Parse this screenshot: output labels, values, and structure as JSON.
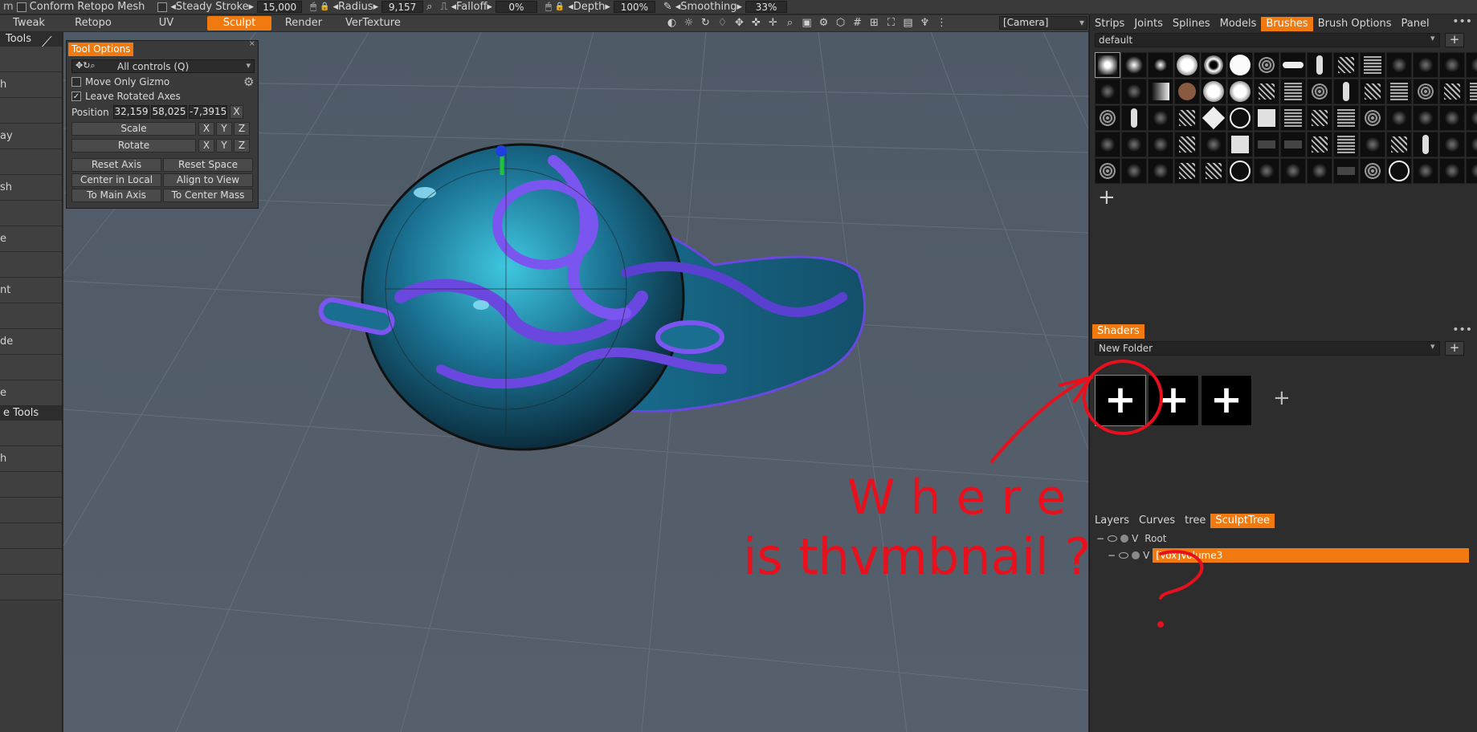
{
  "topbar": {
    "conform_label": "Conform",
    "retopo_mesh_label": "Retopo  Mesh",
    "steady_stroke_label": "◂Steady  Stroke▸",
    "steady_stroke_value": "15,000",
    "radius_label": "◂Radius▸",
    "radius_value": "9,157",
    "falloff_label": "◂Falloff▸",
    "falloff_value": "0%",
    "depth_label": "◂Depth▸",
    "depth_value": "100%",
    "smoothing_label": "◂Smoothing▸",
    "smoothing_value": "33%"
  },
  "tabs": [
    {
      "label": "Tweak"
    },
    {
      "label": "Retopo"
    },
    {
      "label": "UV"
    },
    {
      "label": "Sculpt"
    },
    {
      "label": "Render"
    },
    {
      "label": "VerTexture"
    }
  ],
  "camera_select": "[Camera]",
  "left_panel": {
    "header1": "Tools",
    "header2": "e  Tools",
    "items_a": [
      "",
      "h",
      "",
      "ay",
      "",
      "sh",
      "",
      "e",
      "",
      "nt",
      "",
      "de",
      "",
      "e"
    ],
    "items_b": [
      "",
      "h",
      "",
      "",
      "",
      "",
      ""
    ]
  },
  "tool_options": {
    "title": "Tool  Options",
    "controls_select": "All  controls  (Q)",
    "move_only_gizmo": "Move  Only  Gizmo",
    "leave_rotated_axes": "Leave  Rotated  Axes",
    "position_label": "Position",
    "pos_x": "32,159",
    "pos_y": "58,025",
    "pos_z": "-7,3915",
    "x_btn": "X",
    "y_btn": "Y",
    "z_btn": "Z",
    "scale": "Scale",
    "rotate": "Rotate",
    "reset_axis": "Reset  Axis",
    "reset_space": "Reset  Space",
    "center_in_local": "Center  in  Local",
    "align_to_view": "Align  to  View",
    "to_main_axis": "To  Main  Axis",
    "to_center_mass": "To  Center  Mass"
  },
  "right_panel": {
    "top_tabs": [
      "Strips",
      "Joints",
      "Splines",
      "Models",
      "Brushes",
      "Brush  Options",
      "Panel"
    ],
    "brush_preset": "default",
    "shaders_tab": "Shaders",
    "shader_folder": "New Folder",
    "shader_thumb_glyph": "+",
    "bottom_tabs": [
      "Layers",
      "Curves",
      "tree",
      "SculptTree"
    ],
    "tree_root_v": "V",
    "tree_root": "Root",
    "tree_child_v": "V",
    "tree_child": "[Vox]Volume3",
    "dots": "•••"
  },
  "annotation": {
    "line1": "W  h  e r e",
    "line2": "is thvmbnail ?",
    "color": "#e8101c"
  },
  "colors": {
    "accent": "#f07a10",
    "viewport": "#535e6a",
    "model_blue": "#2aa0d0",
    "model_purple": "#6a48e0"
  }
}
